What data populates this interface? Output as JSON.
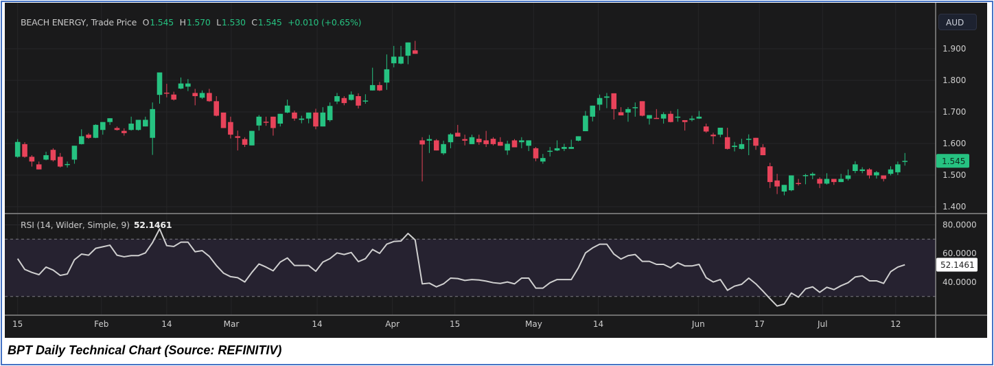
{
  "header": {
    "symbol": "BEACH ENERGY, Trade Price",
    "o_label": "O",
    "o": "1.545",
    "h_label": "H",
    "h": "1.570",
    "l_label": "L",
    "l": "1.530",
    "c_label": "C",
    "c": "1.545",
    "change": "+0.010 (+0.65%)"
  },
  "currency_button": "AUD",
  "caption": "BPT Daily Technical Chart (Source: REFINITIV)",
  "colors": {
    "up": "#26c281",
    "down": "#e8435a",
    "background": "#1a1a1b",
    "rsi_band": "#262230",
    "rsi_line": "#d0d0d0"
  },
  "chart_data": [
    {
      "type": "candlestick",
      "title": "BEACH ENERGY, Trade Price",
      "ylim": [
        1.38,
        1.95
      ],
      "y_ticks": [
        "1.900",
        "1.800",
        "1.700",
        "1.600",
        "1.500",
        "1.400"
      ],
      "last_price_label": "1.545",
      "last_price": 1.545,
      "x_ticks": [
        {
          "label": "15",
          "index": 0
        },
        {
          "label": "Feb",
          "index": 11.8
        },
        {
          "label": "14",
          "index": 21
        },
        {
          "label": "Mar",
          "index": 30.1
        },
        {
          "label": "14",
          "index": 42.2
        },
        {
          "label": "Apr",
          "index": 52.8
        },
        {
          "label": "15",
          "index": 61.6
        },
        {
          "label": "May",
          "index": 72.7
        },
        {
          "label": "14",
          "index": 81.8
        },
        {
          "label": "Jun",
          "index": 95.9
        },
        {
          "label": "17",
          "index": 104.5
        },
        {
          "label": "Jul",
          "index": 113.4
        },
        {
          "label": "12",
          "index": 123.7
        }
      ],
      "ohlc": [
        [
          1.558,
          1.614,
          1.555,
          1.605
        ],
        [
          1.598,
          1.604,
          1.555,
          1.558
        ],
        [
          1.558,
          1.563,
          1.527,
          1.543
        ],
        [
          1.534,
          1.543,
          1.518,
          1.518
        ],
        [
          1.549,
          1.574,
          1.547,
          1.563
        ],
        [
          1.58,
          1.585,
          1.543,
          1.547
        ],
        [
          1.558,
          1.57,
          1.524,
          1.527
        ],
        [
          1.533,
          1.543,
          1.524,
          1.535
        ],
        [
          1.549,
          1.593,
          1.536,
          1.593
        ],
        [
          1.598,
          1.645,
          1.597,
          1.623
        ],
        [
          1.628,
          1.633,
          1.615,
          1.618
        ],
        [
          1.618,
          1.661,
          1.617,
          1.659
        ],
        [
          1.643,
          1.668,
          1.628,
          1.668
        ],
        [
          1.668,
          1.68,
          1.659,
          1.68
        ],
        [
          1.649,
          1.654,
          1.641,
          1.643
        ],
        [
          1.64,
          1.648,
          1.625,
          1.633
        ],
        [
          1.643,
          1.685,
          1.641,
          1.663
        ],
        [
          1.643,
          1.675,
          1.641,
          1.675
        ],
        [
          1.654,
          1.685,
          1.654,
          1.675
        ],
        [
          1.618,
          1.73,
          1.564,
          1.709
        ],
        [
          1.754,
          1.825,
          1.726,
          1.825
        ],
        [
          1.761,
          1.789,
          1.746,
          1.759
        ],
        [
          1.755,
          1.764,
          1.736,
          1.739
        ],
        [
          1.774,
          1.809,
          1.772,
          1.79
        ],
        [
          1.78,
          1.804,
          1.766,
          1.79
        ],
        [
          1.76,
          1.773,
          1.721,
          1.75
        ],
        [
          1.745,
          1.768,
          1.741,
          1.76
        ],
        [
          1.76,
          1.773,
          1.732,
          1.734
        ],
        [
          1.734,
          1.75,
          1.686,
          1.688
        ],
        [
          1.698,
          1.698,
          1.649,
          1.649
        ],
        [
          1.668,
          1.685,
          1.616,
          1.628
        ],
        [
          1.623,
          1.641,
          1.578,
          1.618
        ],
        [
          1.614,
          1.62,
          1.589,
          1.596
        ],
        [
          1.594,
          1.64,
          1.594,
          1.64
        ],
        [
          1.657,
          1.69,
          1.641,
          1.685
        ],
        [
          1.669,
          1.685,
          1.656,
          1.668
        ],
        [
          1.685,
          1.685,
          1.625,
          1.649
        ],
        [
          1.663,
          1.694,
          1.654,
          1.694
        ],
        [
          1.698,
          1.739,
          1.696,
          1.72
        ],
        [
          1.698,
          1.704,
          1.672,
          1.679
        ],
        [
          1.675,
          1.688,
          1.664,
          1.679
        ],
        [
          1.679,
          1.698,
          1.664,
          1.698
        ],
        [
          1.698,
          1.71,
          1.645,
          1.654
        ],
        [
          1.654,
          1.715,
          1.654,
          1.698
        ],
        [
          1.674,
          1.73,
          1.669,
          1.719
        ],
        [
          1.733,
          1.76,
          1.725,
          1.75
        ],
        [
          1.744,
          1.75,
          1.721,
          1.728
        ],
        [
          1.738,
          1.765,
          1.736,
          1.755
        ],
        [
          1.75,
          1.759,
          1.711,
          1.72
        ],
        [
          1.734,
          1.756,
          1.726,
          1.736
        ],
        [
          1.768,
          1.84,
          1.768,
          1.785
        ],
        [
          1.785,
          1.795,
          1.766,
          1.768
        ],
        [
          1.793,
          1.882,
          1.77,
          1.835
        ],
        [
          1.854,
          1.909,
          1.841,
          1.875
        ],
        [
          1.853,
          1.909,
          1.851,
          1.875
        ],
        [
          1.878,
          1.92,
          1.851,
          1.92
        ],
        [
          1.895,
          1.925,
          1.884,
          1.884
        ],
        [
          1.61,
          1.62,
          1.48,
          1.597
        ],
        [
          1.609,
          1.627,
          1.57,
          1.614
        ],
        [
          1.61,
          1.614,
          1.578,
          1.578
        ],
        [
          1.569,
          1.609,
          1.564,
          1.598
        ],
        [
          1.604,
          1.633,
          1.585,
          1.629
        ],
        [
          1.634,
          1.659,
          1.622,
          1.622
        ],
        [
          1.614,
          1.628,
          1.594,
          1.609
        ],
        [
          1.598,
          1.628,
          1.598,
          1.62
        ],
        [
          1.615,
          1.628,
          1.596,
          1.604
        ],
        [
          1.61,
          1.64,
          1.589,
          1.598
        ],
        [
          1.615,
          1.62,
          1.594,
          1.598
        ],
        [
          1.605,
          1.62,
          1.593,
          1.593
        ],
        [
          1.578,
          1.609,
          1.564,
          1.599
        ],
        [
          1.61,
          1.614,
          1.588,
          1.588
        ],
        [
          1.604,
          1.62,
          1.585,
          1.61
        ],
        [
          1.593,
          1.61,
          1.576,
          1.61
        ],
        [
          1.585,
          1.589,
          1.544,
          1.553
        ],
        [
          1.543,
          1.567,
          1.536,
          1.554
        ],
        [
          1.575,
          1.589,
          1.559,
          1.577
        ],
        [
          1.578,
          1.61,
          1.576,
          1.585
        ],
        [
          1.583,
          1.599,
          1.576,
          1.589
        ],
        [
          1.583,
          1.612,
          1.583,
          1.589
        ],
        [
          1.609,
          1.623,
          1.607,
          1.623
        ],
        [
          1.639,
          1.703,
          1.639,
          1.688
        ],
        [
          1.685,
          1.72,
          1.67,
          1.72
        ],
        [
          1.723,
          1.755,
          1.705,
          1.744
        ],
        [
          1.745,
          1.76,
          1.712,
          1.749
        ],
        [
          1.759,
          1.759,
          1.676,
          1.709
        ],
        [
          1.699,
          1.715,
          1.689,
          1.689
        ],
        [
          1.698,
          1.715,
          1.669,
          1.709
        ],
        [
          1.713,
          1.73,
          1.685,
          1.715
        ],
        [
          1.734,
          1.734,
          1.686,
          1.688
        ],
        [
          1.679,
          1.69,
          1.66,
          1.69
        ],
        [
          1.681,
          1.709,
          1.678,
          1.68
        ],
        [
          1.679,
          1.699,
          1.663,
          1.693
        ],
        [
          1.694,
          1.703,
          1.667,
          1.668
        ],
        [
          1.684,
          1.709,
          1.669,
          1.685
        ],
        [
          1.674,
          1.674,
          1.641,
          1.668
        ],
        [
          1.675,
          1.688,
          1.67,
          1.679
        ],
        [
          1.679,
          1.703,
          1.678,
          1.685
        ],
        [
          1.654,
          1.663,
          1.634,
          1.638
        ],
        [
          1.628,
          1.634,
          1.598,
          1.623
        ],
        [
          1.628,
          1.65,
          1.62,
          1.65
        ],
        [
          1.62,
          1.65,
          1.581,
          1.583
        ],
        [
          1.589,
          1.605,
          1.575,
          1.593
        ],
        [
          1.583,
          1.615,
          1.581,
          1.598
        ],
        [
          1.613,
          1.629,
          1.563,
          1.615
        ],
        [
          1.618,
          1.618,
          1.58,
          1.593
        ],
        [
          1.588,
          1.598,
          1.563,
          1.563
        ],
        [
          1.528,
          1.539,
          1.459,
          1.478
        ],
        [
          1.483,
          1.504,
          1.44,
          1.464
        ],
        [
          1.448,
          1.469,
          1.436,
          1.469
        ],
        [
          1.452,
          1.499,
          1.449,
          1.499
        ],
        [
          1.475,
          1.488,
          1.467,
          1.473
        ],
        [
          1.499,
          1.504,
          1.471,
          1.5
        ],
        [
          1.499,
          1.509,
          1.487,
          1.504
        ],
        [
          1.488,
          1.493,
          1.459,
          1.473
        ],
        [
          1.473,
          1.506,
          1.47,
          1.488
        ],
        [
          1.488,
          1.488,
          1.469,
          1.478
        ],
        [
          1.478,
          1.504,
          1.478,
          1.488
        ],
        [
          1.488,
          1.518,
          1.483,
          1.499
        ],
        [
          1.513,
          1.544,
          1.506,
          1.534
        ],
        [
          1.513,
          1.525,
          1.506,
          1.518
        ],
        [
          1.518,
          1.522,
          1.489,
          1.499
        ],
        [
          1.499,
          1.513,
          1.489,
          1.509
        ],
        [
          1.499,
          1.499,
          1.48,
          1.488
        ],
        [
          1.504,
          1.528,
          1.499,
          1.518
        ],
        [
          1.509,
          1.543,
          1.5,
          1.534
        ],
        [
          1.545,
          1.57,
          1.53,
          1.545
        ]
      ]
    },
    {
      "type": "line",
      "title": "RSI (14, Wilder, Simple, 9)",
      "last_value_label": "52.1461",
      "ylim": [
        15,
        85
      ],
      "y_ticks": [
        "80.0000",
        "60.0000",
        "40.0000"
      ],
      "bands": [
        30,
        70
      ],
      "values": [
        56.4,
        48.9,
        46.8,
        45.2,
        50.5,
        48.4,
        44.7,
        45.7,
        55.6,
        59.6,
        58.8,
        63.6,
        64.7,
        65.8,
        58.8,
        57.7,
        58.5,
        58.5,
        60.4,
        67.6,
        77.2,
        65.5,
        64.9,
        67.9,
        67.9,
        61.2,
        62.0,
        58.0,
        51.6,
        46.3,
        43.8,
        43.1,
        40.1,
        46.8,
        52.7,
        50.5,
        47.9,
        54.0,
        56.9,
        51.6,
        51.6,
        51.6,
        47.6,
        54.0,
        56.4,
        60.4,
        59.3,
        60.7,
        54.3,
        56.4,
        62.8,
        60.1,
        66.5,
        68.4,
        68.7,
        74.0,
        69.5,
        38.8,
        39.3,
        36.7,
        38.8,
        42.8,
        42.5,
        41.2,
        41.8,
        41.5,
        40.7,
        39.6,
        39.1,
        40.1,
        38.8,
        42.8,
        42.8,
        35.8,
        35.8,
        39.6,
        41.8,
        41.8,
        41.8,
        50.0,
        60.4,
        63.9,
        66.5,
        66.5,
        59.6,
        56.1,
        58.5,
        59.3,
        54.5,
        54.5,
        52.4,
        52.4,
        50.0,
        53.5,
        51.3,
        51.3,
        52.4,
        43.1,
        40.1,
        41.8,
        34.3,
        37.2,
        38.5,
        42.8,
        38.8,
        33.7,
        28.4,
        23.3,
        24.7,
        32.4,
        29.5,
        35.3,
        36.7,
        32.9,
        36.4,
        34.8,
        37.5,
        39.6,
        43.6,
        44.4,
        40.9,
        40.9,
        39.1,
        47.3,
        50.5,
        52.1461
      ]
    }
  ]
}
